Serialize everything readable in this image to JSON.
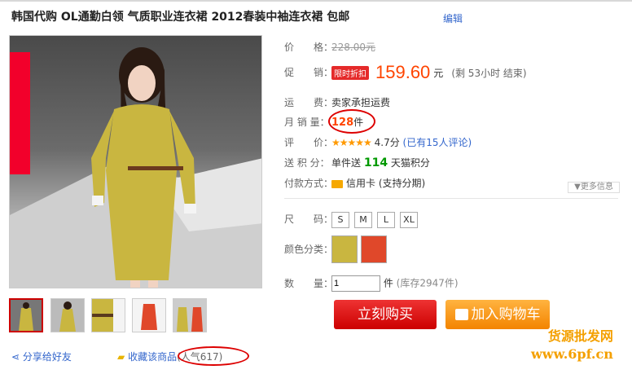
{
  "product": {
    "title": "韩国代购 OL通勤白领 气质职业连衣裙 2012春装中袖连衣裙 包邮",
    "edit_label": "编辑"
  },
  "details": {
    "price_label": "价　　格：",
    "original_price": "228.00元",
    "promo_label": "促　　销：",
    "promo_badge": "限时折扣",
    "promo_price": "159.60",
    "promo_unit": "元",
    "remain": "(剩 53小时 结束)",
    "shipping_label": "运　　费：",
    "shipping_value": "卖家承担运费",
    "sales_label": "月 销 量：",
    "sales_value": "128",
    "sales_unit": "件",
    "rating_label": "评　　价：",
    "rating_stars": "★★★★★",
    "rating_score": "4.7分",
    "rating_reviews": "(已有15人评论)",
    "points_label": "送 积 分：",
    "points_prefix": "单件送",
    "points_value": "114",
    "points_suffix": "天猫积分",
    "payment_label": "付款方式：",
    "payment_value": "信用卡 (支持分期)",
    "more_info": "▼更多信息"
  },
  "options": {
    "size_label": "尺　　码：",
    "sizes": [
      "S",
      "M",
      "L",
      "XL"
    ],
    "color_label": "颜色分类：",
    "qty_label": "数　　量：",
    "qty_value": "1",
    "qty_unit": "件",
    "stock": "(库存2947件)"
  },
  "actions": {
    "buy_now": "立刻购买",
    "add_cart": "加入购物车",
    "share": "分享给好友",
    "favorite": "收藏该商品",
    "popularity": "(人气617)"
  },
  "watermark": {
    "line1": "货源批发网",
    "line2": "www.6pf.cn"
  },
  "colors": {
    "price": "#ff4400",
    "buy": "#cc0000",
    "cart": "#f38400",
    "dress": "#c9b640"
  }
}
